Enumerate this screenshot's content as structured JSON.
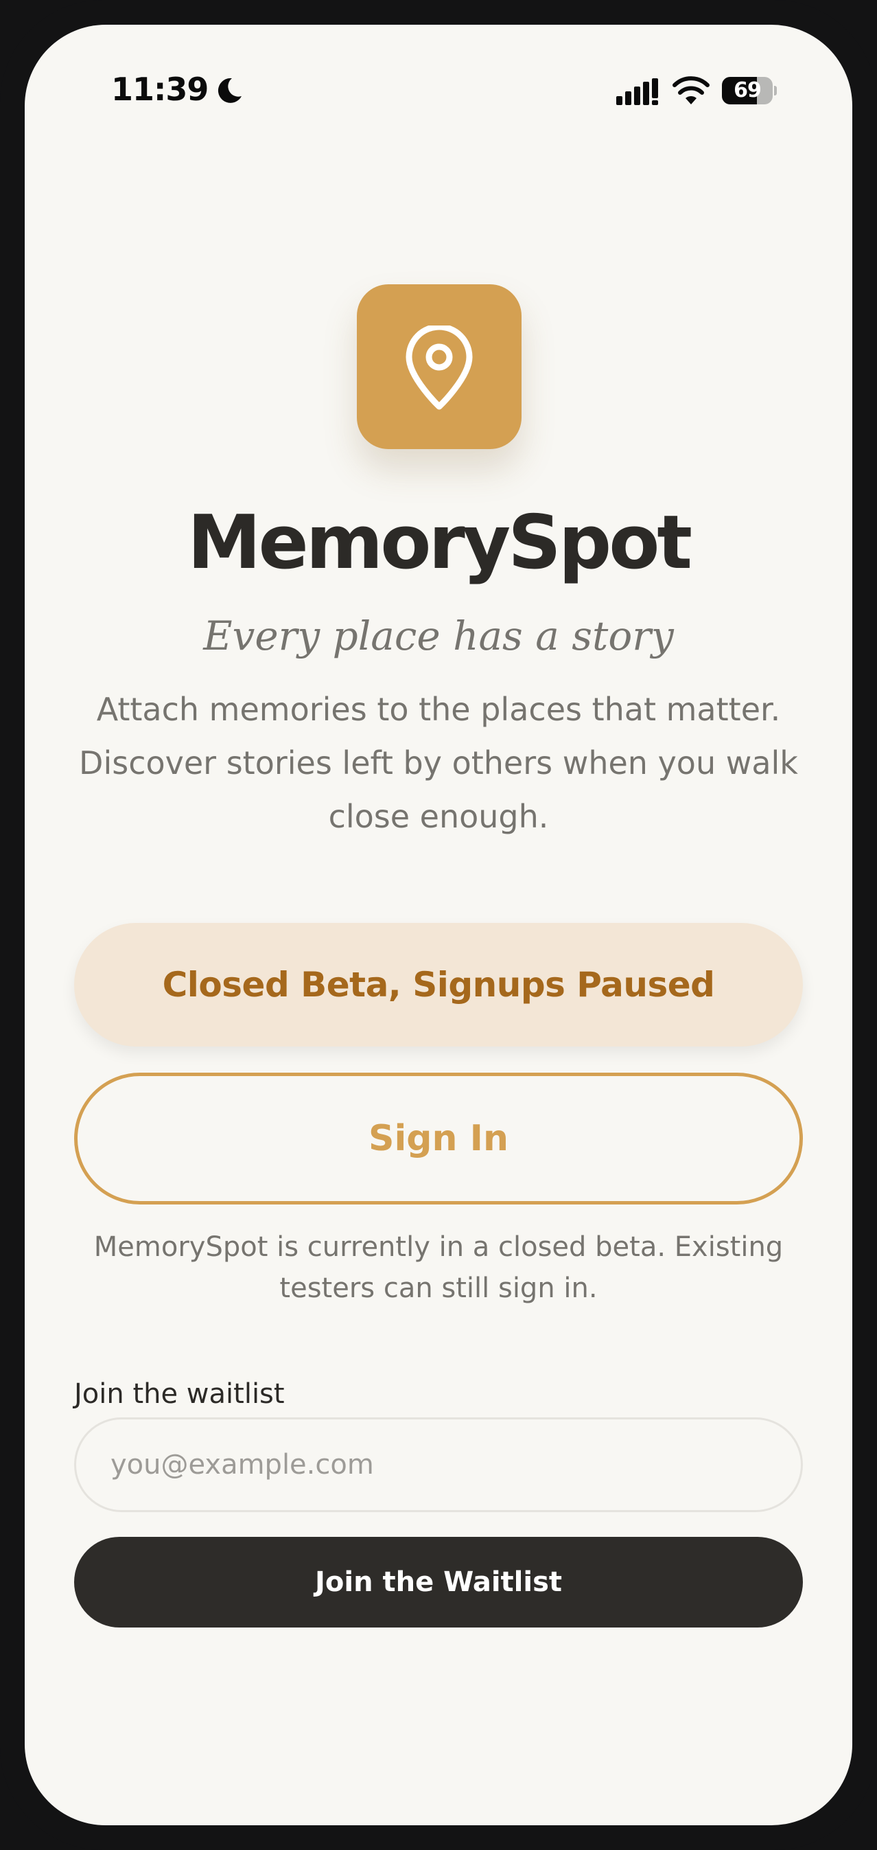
{
  "status_bar": {
    "time": "11:39",
    "battery_level": "69",
    "battery_fraction": 0.69,
    "icons": [
      "moon-icon",
      "cellular-signal-icon",
      "wifi-icon",
      "battery-icon"
    ]
  },
  "app": {
    "icon": "map-pin-icon",
    "title": "MemorySpot",
    "tagline": "Every place has a story",
    "description": "Attach memories to the places that matter. Discover stories left by others when you walk close enough."
  },
  "actions": {
    "beta_label": "Closed Beta, Signups Paused",
    "signin_label": "Sign In",
    "beta_note": "MemorySpot is currently in a closed beta. Existing testers can still sign in."
  },
  "waitlist": {
    "label": "Join the waitlist",
    "email_value": "",
    "email_placeholder": "you@example.com",
    "button_label": "Join the Waitlist"
  },
  "colors": {
    "accent": "#d4a052",
    "accent_dark": "#a5681c",
    "beta_bg": "#f3e6d6",
    "background": "#f8f7f3",
    "text_primary": "#2c2a27",
    "text_muted": "#76746f",
    "button_dark": "#2e2c29"
  }
}
